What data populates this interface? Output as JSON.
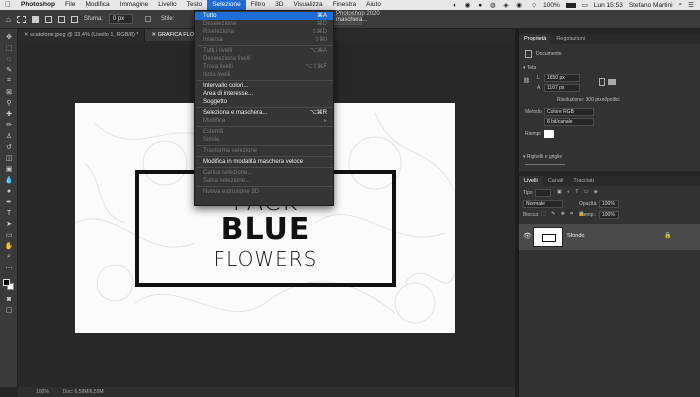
{
  "menubar": {
    "apple": "",
    "items": [
      "Photoshop",
      "File",
      "Modifica",
      "Immagine",
      "Livello",
      "Testo",
      "Selezione",
      "Filtro",
      "3D",
      "Visualizza",
      "Finestra",
      "Aiuto"
    ],
    "active_index": 6,
    "battery": "100%",
    "clock": "Lun 15:53",
    "user": "Stefano Martini"
  },
  "options_bar": {
    "sfuma_label": "Sfuma:",
    "sfuma_value": "0 px",
    "stile_label": "Stile:",
    "app_title": "Photoshop 2020",
    "maschera_button": "maschera..."
  },
  "tabs": [
    "scatolone.jpeg @ 33,4% (Livello 1, RGB/8) *",
    "GRAFICA FLORA.jpg"
  ],
  "selezione_menu": {
    "items": [
      {
        "label": "Tutto",
        "shortcut": "⌘A",
        "state": "hl"
      },
      {
        "label": "Deseleziona",
        "shortcut": "⌘D",
        "state": "disabled"
      },
      {
        "label": "Riseleziona",
        "shortcut": "⇧⌘D",
        "state": "disabled"
      },
      {
        "label": "Inversa",
        "shortcut": "⇧⌘I",
        "state": "disabled"
      },
      {
        "sep": true
      },
      {
        "label": "Tutti i livelli",
        "shortcut": "⌥⌘A",
        "state": "disabled"
      },
      {
        "label": "Deseleziona livelli",
        "shortcut": "",
        "state": "disabled"
      },
      {
        "label": "Trova livelli",
        "shortcut": "⌥⇧⌘F",
        "state": "disabled"
      },
      {
        "label": "Isola livelli",
        "shortcut": "",
        "state": "disabled"
      },
      {
        "sep": true
      },
      {
        "label": "Intervallo colori...",
        "shortcut": "",
        "state": "enabled"
      },
      {
        "label": "Area di interesse...",
        "shortcut": "",
        "state": "enabled"
      },
      {
        "label": "Soggetto",
        "shortcut": "",
        "state": "enabled"
      },
      {
        "sep": true
      },
      {
        "label": "Seleziona e maschera...",
        "shortcut": "⌥⌘R",
        "state": "enabled"
      },
      {
        "label": "Modifica",
        "shortcut": "▸",
        "state": "disabled"
      },
      {
        "sep": true
      },
      {
        "label": "Estendi",
        "shortcut": "",
        "state": "disabled"
      },
      {
        "label": "Simile",
        "shortcut": "",
        "state": "disabled"
      },
      {
        "sep": true
      },
      {
        "label": "Trasforma selezione",
        "shortcut": "",
        "state": "disabled"
      },
      {
        "sep": true
      },
      {
        "label": "Modifica in modalità maschera veloce",
        "shortcut": "",
        "state": "enabled"
      },
      {
        "sep": true
      },
      {
        "label": "Carica selezione...",
        "shortcut": "",
        "state": "disabled"
      },
      {
        "label": "Salva selezione...",
        "shortcut": "",
        "state": "disabled"
      },
      {
        "sep": true
      },
      {
        "label": "Nuova estrusione 3D",
        "shortcut": "",
        "state": "disabled"
      }
    ]
  },
  "artwork": {
    "line1": "PACK",
    "line2": "BLUE",
    "line3": "FLOWERS"
  },
  "statusbar": {
    "zoom": "100%",
    "doc": "Doc: 6,59M/6,59M"
  },
  "properties_panel": {
    "tab_properties": "Proprietà",
    "tab_adjustments": "Regolazioni",
    "document_label": "Documento",
    "canvas_section": "Tela",
    "width_label": "L",
    "width_value": "1650 px",
    "height_label": "A",
    "height_value": "1167 px",
    "resolution": "Risoluzione: 300 pixel/pollici",
    "method_label": "Metodo",
    "method_value": "Colore RGB",
    "bit_value": "8 bit/canale",
    "fill_label": "Riempi",
    "rulers_section": "Righelli e griglie"
  },
  "layers_panel": {
    "tab_layers": "Livelli",
    "tab_channels": "Canali",
    "tab_paths": "Tracciati",
    "kind_label": "Tipo",
    "mode_value": "Normale",
    "opacity_label": "Opacità:",
    "opacity_value": "100%",
    "lock_label": "Blocca:",
    "fill_label": "Riemp.:",
    "fill_value": "100%",
    "layer_name": "Sfondo"
  },
  "colors": {
    "menu_highlight": "#1f6ed8",
    "panel_bg": "#323232",
    "canvas_bg": "#282828"
  }
}
